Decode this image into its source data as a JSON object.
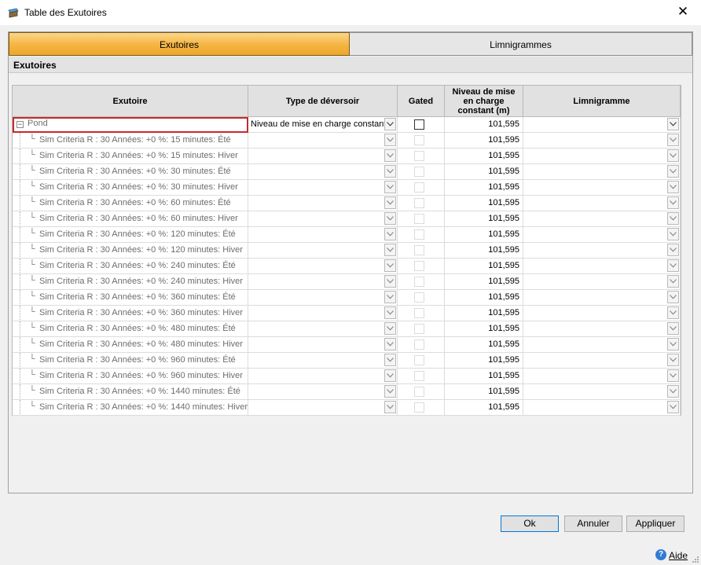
{
  "window": {
    "title": "Table des Exutoires",
    "close_glyph": "✕"
  },
  "tabs": [
    {
      "label": "Exutoires",
      "active": true
    },
    {
      "label": "Limnigrammes",
      "active": false
    }
  ],
  "section_title": "Exutoires",
  "grid": {
    "columns": [
      "Exutoire",
      "Type de déversoir",
      "Gated",
      "Niveau de mise\nen charge\nconstant (m)",
      "Limnigramme"
    ],
    "parent_row": {
      "label": "Pond",
      "type": "Niveau de mise en charge constant",
      "gated": false,
      "level": "101,595",
      "limnigramme": ""
    },
    "child_rows": [
      {
        "label": "Sim Criteria R : 30 Années: +0 %: 15 minutes: Été",
        "level": "101,595"
      },
      {
        "label": "Sim Criteria R : 30 Années: +0 %: 15 minutes: Hiver",
        "level": "101,595"
      },
      {
        "label": "Sim Criteria R : 30 Années: +0 %: 30 minutes: Été",
        "level": "101,595"
      },
      {
        "label": "Sim Criteria R : 30 Années: +0 %: 30 minutes: Hiver",
        "level": "101,595"
      },
      {
        "label": "Sim Criteria R : 30 Années: +0 %: 60 minutes: Été",
        "level": "101,595"
      },
      {
        "label": "Sim Criteria R : 30 Années: +0 %: 60 minutes: Hiver",
        "level": "101,595"
      },
      {
        "label": "Sim Criteria R : 30 Années: +0 %: 120 minutes: Été",
        "level": "101,595"
      },
      {
        "label": "Sim Criteria R : 30 Années: +0 %: 120 minutes: Hiver",
        "level": "101,595"
      },
      {
        "label": "Sim Criteria R : 30 Années: +0 %: 240 minutes: Été",
        "level": "101,595"
      },
      {
        "label": "Sim Criteria R : 30 Années: +0 %: 240 minutes: Hiver",
        "level": "101,595"
      },
      {
        "label": "Sim Criteria R : 30 Années: +0 %: 360 minutes: Été",
        "level": "101,595"
      },
      {
        "label": "Sim Criteria R : 30 Années: +0 %: 360 minutes: Hiver",
        "level": "101,595"
      },
      {
        "label": "Sim Criteria R : 30 Années: +0 %: 480 minutes: Été",
        "level": "101,595"
      },
      {
        "label": "Sim Criteria R : 30 Années: +0 %: 480 minutes: Hiver",
        "level": "101,595"
      },
      {
        "label": "Sim Criteria R : 30 Années: +0 %: 960 minutes: Été",
        "level": "101,595"
      },
      {
        "label": "Sim Criteria R : 30 Années: +0 %: 960 minutes: Hiver",
        "level": "101,595"
      },
      {
        "label": "Sim Criteria R : 30 Années: +0 %: 1440 minutes: Été",
        "level": "101,595"
      },
      {
        "label": "Sim Criteria R : 30 Années: +0 %: 1440 minutes: Hiver",
        "level": "101,595"
      }
    ]
  },
  "buttons": {
    "ok": "Ok",
    "cancel": "Annuler",
    "apply": "Appliquer"
  },
  "help": {
    "label": "Aide"
  },
  "colors": {
    "active_tab": "#f5b441",
    "selection_outline": "#c52b2b",
    "help_icon": "#2f7bd6"
  }
}
